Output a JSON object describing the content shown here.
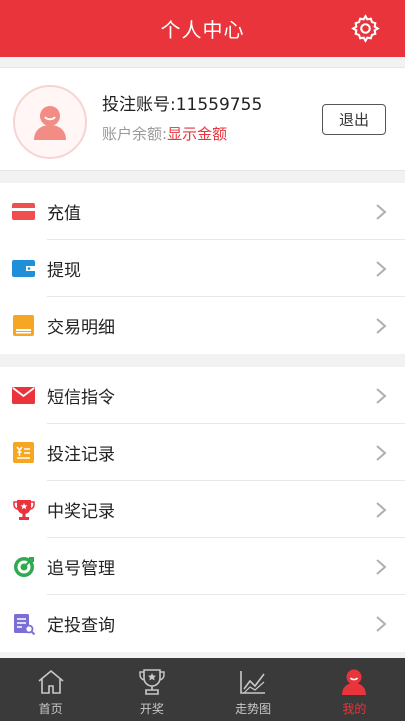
{
  "header": {
    "title": "个人中心",
    "settings_icon": "gear-icon"
  },
  "profile": {
    "account_label": "投注账号:11559755",
    "balance_label": "账户余额:",
    "balance_link": "显示金额",
    "logout_label": "退出"
  },
  "menu_group_1": [
    {
      "label": "充值",
      "icon": "credit-card-icon"
    },
    {
      "label": "提现",
      "icon": "wallet-icon"
    },
    {
      "label": "交易明细",
      "icon": "ledger-icon"
    }
  ],
  "menu_group_2": [
    {
      "label": "短信指令",
      "icon": "envelope-icon"
    },
    {
      "label": "投注记录",
      "icon": "bet-record-icon"
    },
    {
      "label": "中奖记录",
      "icon": "trophy-icon"
    },
    {
      "label": "追号管理",
      "icon": "target-icon"
    },
    {
      "label": "定投查询",
      "icon": "document-search-icon"
    }
  ],
  "tabbar": [
    {
      "label": "首页",
      "icon": "home-icon",
      "active": false
    },
    {
      "label": "开奖",
      "icon": "trophy-outline-icon",
      "active": false
    },
    {
      "label": "走势图",
      "icon": "trend-chart-icon",
      "active": false
    },
    {
      "label": "我的",
      "icon": "user-icon",
      "active": true
    }
  ],
  "colors": {
    "brand": "#e8343a",
    "tabbar": "#3a3a3a"
  }
}
